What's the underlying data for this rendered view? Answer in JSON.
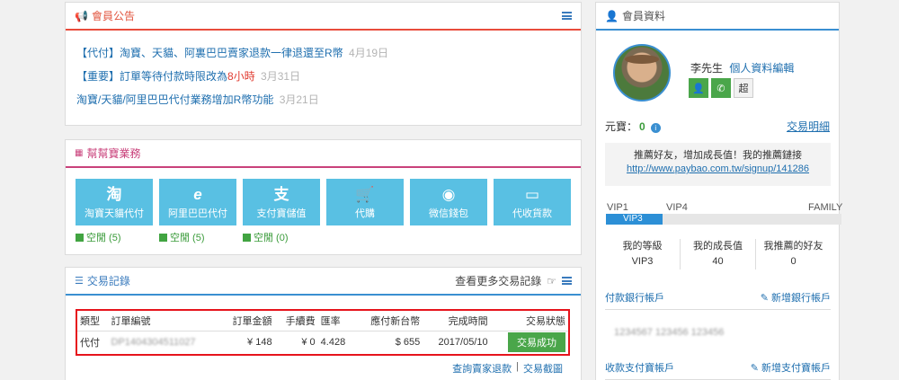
{
  "announcement": {
    "title": "會員公告",
    "items": [
      {
        "text": "【代付】淘寶、天貓、阿裏巴巴賣家退款一律退還至R幣",
        "date": "4月19日"
      },
      {
        "prefix": "【重要】訂單等待付款時限改為",
        "highlight": "8小時",
        "date": "3月31日"
      },
      {
        "text": "淘寶/天貓/阿里巴巴代付業務增加R幣功能",
        "date": "3月21日"
      }
    ]
  },
  "services": {
    "title": "幫幫寶業務",
    "tiles": [
      {
        "glyph": "淘",
        "label": "淘寶天貓代付"
      },
      {
        "glyph": "e",
        "label": "阿里巴巴代付"
      },
      {
        "glyph": "支",
        "label": "支付寶儲值"
      },
      {
        "glyph": "🛒",
        "label": "代購"
      },
      {
        "glyph": "◉",
        "label": "微信錢包"
      },
      {
        "glyph": "▭",
        "label": "代收貨款"
      }
    ],
    "statuses": [
      "空閒 (5)",
      "空閒 (5)",
      "空閒 (0)"
    ]
  },
  "transactions": {
    "title": "交易記錄",
    "more": "查看更多交易記錄",
    "columns": [
      "類型",
      "訂單編號",
      "訂單金額",
      "手續費",
      "匯率",
      "應付新台幣",
      "完成時間",
      "交易狀態"
    ],
    "rows": [
      {
        "type": "代付",
        "order": "DP1404304511027",
        "amount": "¥ 148",
        "fee": "¥ 0",
        "rate": "4.428",
        "twd": "$ 655",
        "time": "2017/05/10",
        "status": "交易成功"
      }
    ],
    "links": [
      "查詢賣家退款",
      "交易截圖"
    ]
  },
  "member": {
    "title": "會員資料",
    "name": "李先生",
    "edit": "個人資料編輯",
    "btn3": "超",
    "coins_label": "元寶：",
    "coins_value": "0",
    "coins_link": "交易明細",
    "refer_text": "推薦好友，增加成長值！我的推薦鏈接",
    "refer_url": "http://www.paybao.com.tw/signup/141286",
    "vip_labels": [
      "VIP1",
      "VIP4",
      "FAMILY"
    ],
    "vip_current": "VIP3",
    "vip_progress": 0.24,
    "stats": [
      {
        "label": "我的等級",
        "value": "VIP3"
      },
      {
        "label": "我的成長值",
        "value": "40"
      },
      {
        "label": "我推薦的好友",
        "value": "0"
      }
    ],
    "bank_title": "付款銀行帳戶",
    "bank_add": "新增銀行帳戶",
    "bank_account": "1234567  123456 123456",
    "alipay_title": "收款支付寶帳戶",
    "alipay_add": "新增支付寶帳戶"
  }
}
